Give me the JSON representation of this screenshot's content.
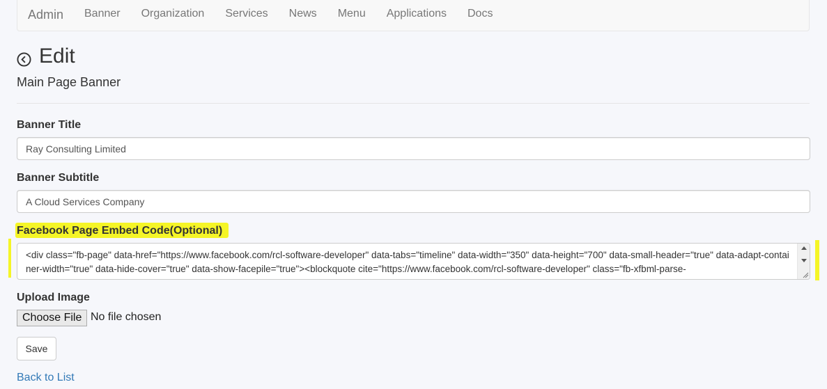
{
  "nav": {
    "brand": "Admin",
    "links": [
      "Banner",
      "Organization",
      "Services",
      "News",
      "Menu",
      "Applications",
      "Docs"
    ]
  },
  "page": {
    "title": "Edit",
    "subtitle": "Main Page Banner"
  },
  "form": {
    "banner_title_label": "Banner Title",
    "banner_title_value": "Ray Consulting Limited",
    "banner_subtitle_label": "Banner Subtitle",
    "banner_subtitle_value": "A Cloud Services Company",
    "embed_label": "Facebook Page Embed Code(Optional)",
    "embed_value": "<div class=\"fb-page\" data-href=\"https://www.facebook.com/rcl-software-developer\" data-tabs=\"timeline\" data-width=\"350\" data-height=\"700\" data-small-header=\"true\" data-adapt-container-width=\"true\" data-hide-cover=\"true\" data-show-facepile=\"true\"><blockquote cite=\"https://www.facebook.com/rcl-software-developer\" class=\"fb-xfbml-parse-",
    "upload_label": "Upload Image",
    "choose_file_label": "Choose File",
    "file_status": "No file chosen",
    "save_label": "Save"
  },
  "footer": {
    "back_link": "Back to List"
  },
  "colors": {
    "highlight": "#f5f527",
    "link": "#337ab7"
  }
}
